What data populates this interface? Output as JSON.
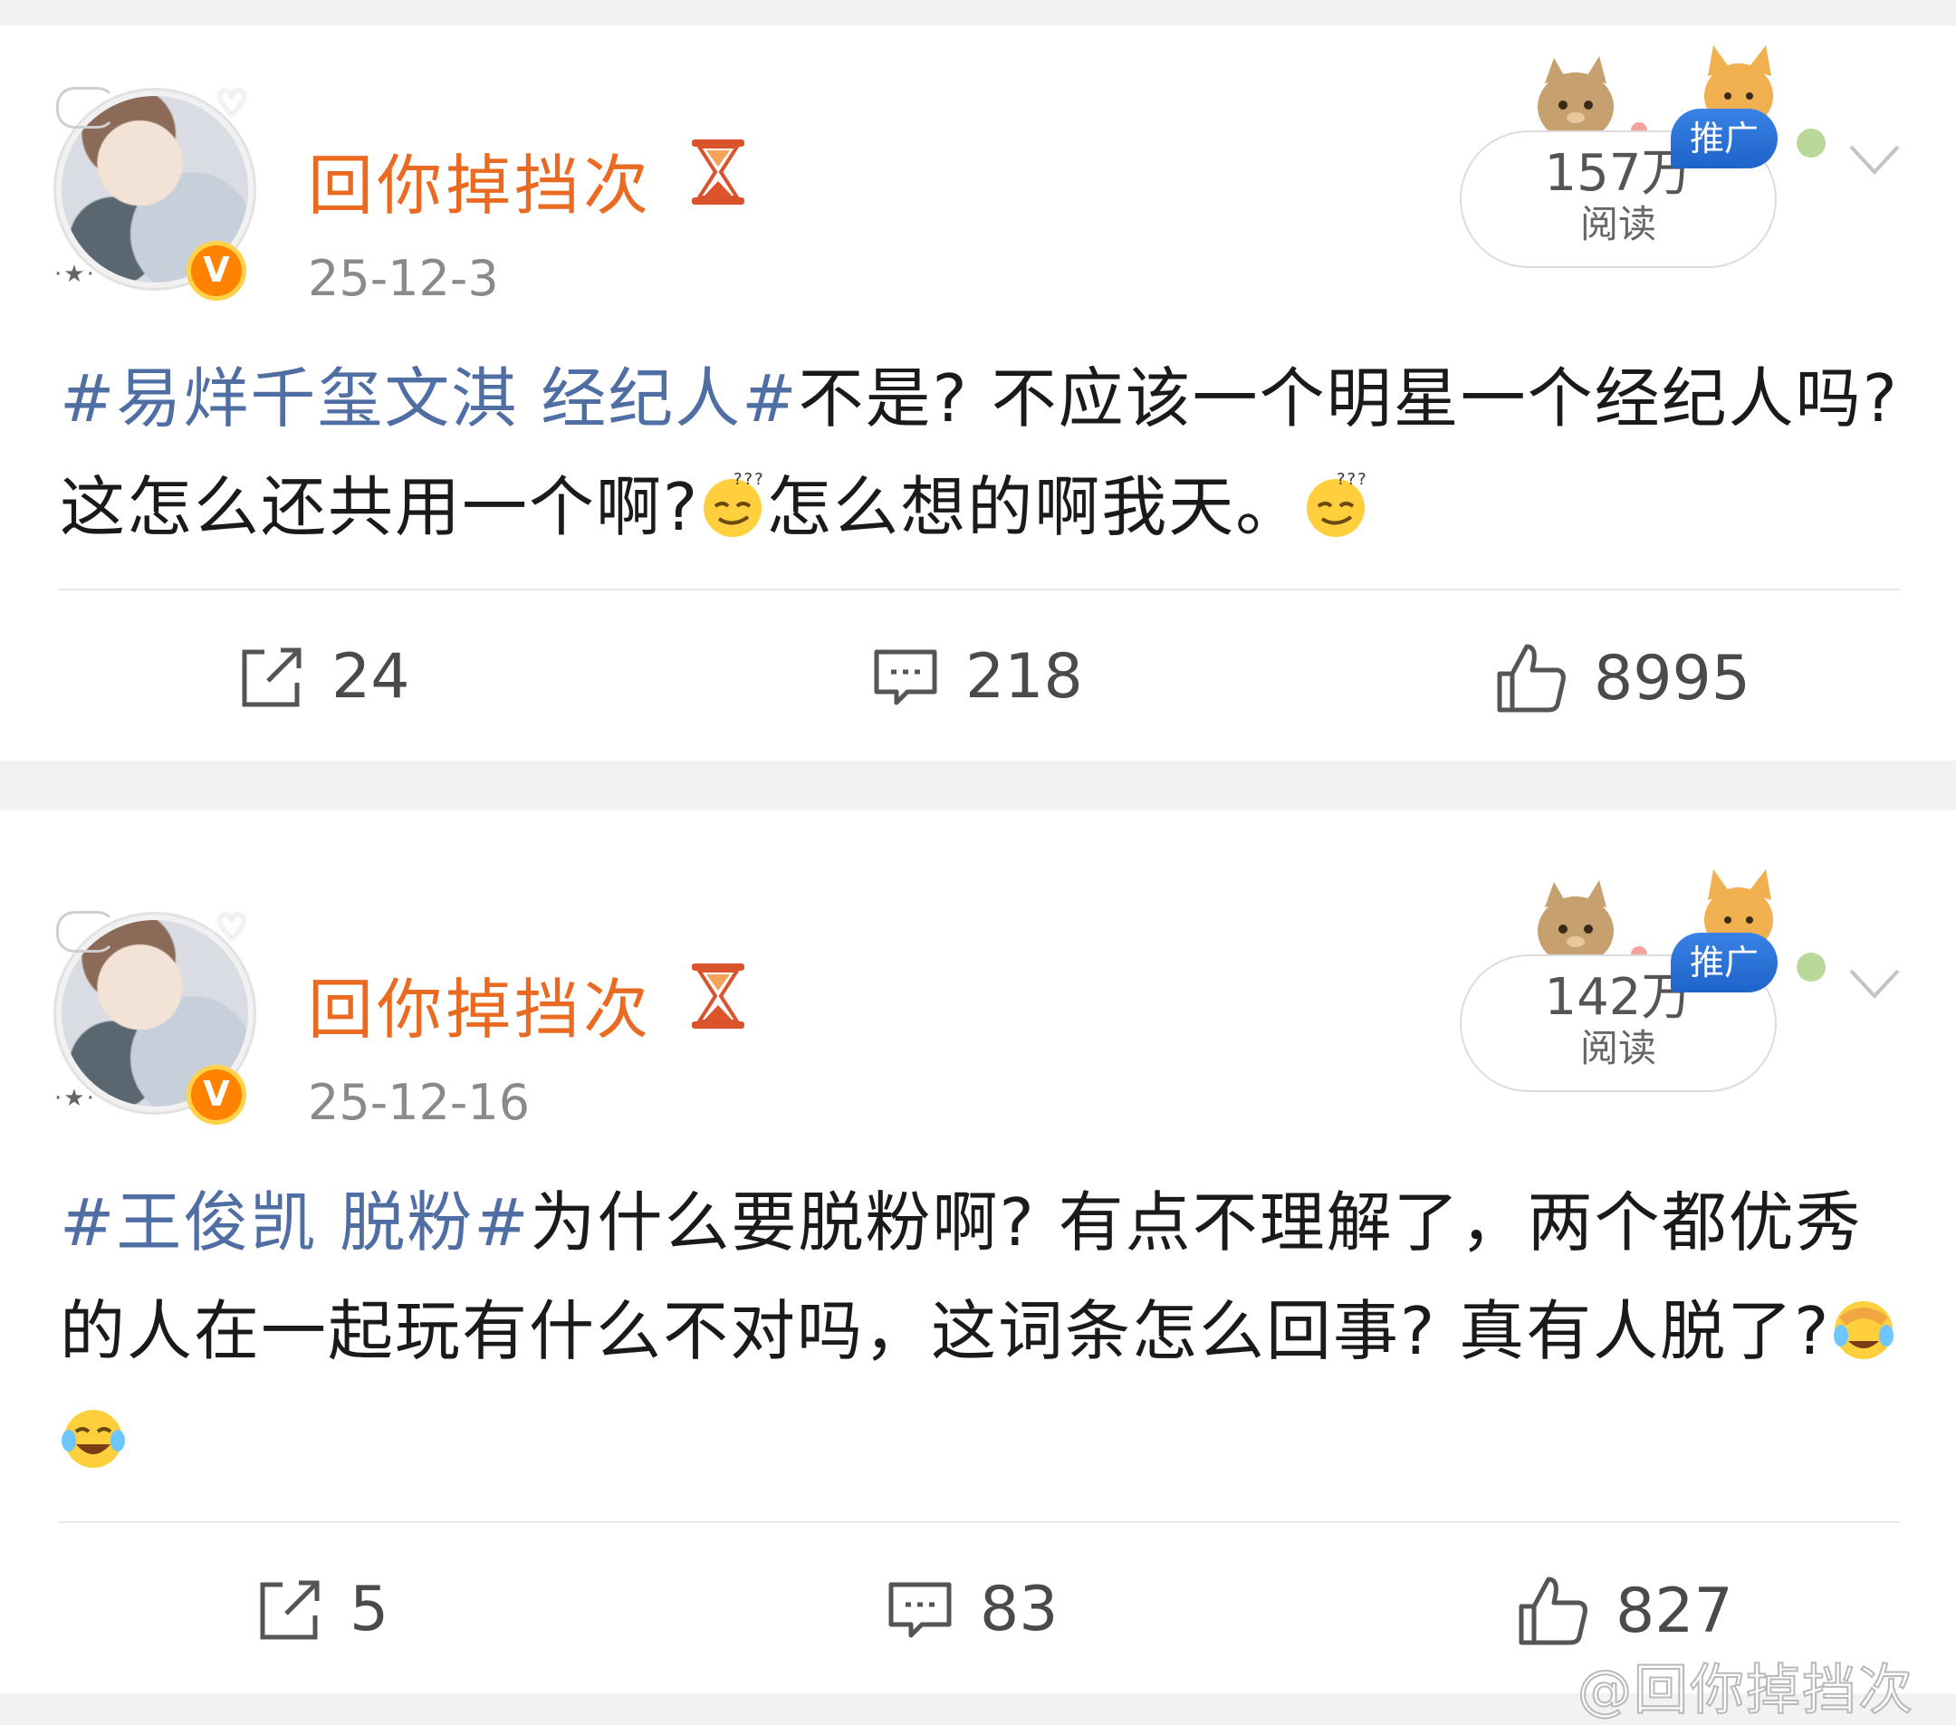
{
  "posts": [
    {
      "username": "回你掉挡次",
      "date": "25-12-3",
      "read_count": "157万",
      "read_label": "阅读",
      "promo_label": "推广",
      "topic": "#易烊千玺文淇 经纪人#",
      "text_part1": "不是? 不应该一个明星一个经纪人吗? 这怎么还共用一个啊?",
      "emoji1": "thinking-squint-emoji",
      "text_part2": "怎么想的啊我天。",
      "emoji2": "thinking-squint-emoji",
      "reposts": "24",
      "comments": "218",
      "likes": "8995"
    },
    {
      "username": "回你掉挡次",
      "date": "25-12-16",
      "read_count": "142万",
      "read_label": "阅读",
      "promo_label": "推广",
      "topic": "#王俊凯 脱粉#",
      "text_part1": "为什么要脱粉啊? 有点不理解了，两个都优秀的人在一起玩有什么不对吗，这词条怎么回事? 真有人脱了?",
      "emoji1": "facepalm-laugh-emoji",
      "emoji2": "tears-of-joy-emoji",
      "reposts": "5",
      "comments": "83",
      "likes": "827"
    }
  ],
  "watermark": "@回你掉挡次",
  "colors": {
    "username": "#ea6a22",
    "topic": "#4f6ea3",
    "verified_badge": "#ff8200",
    "promo_badge": "#1e63c9"
  }
}
